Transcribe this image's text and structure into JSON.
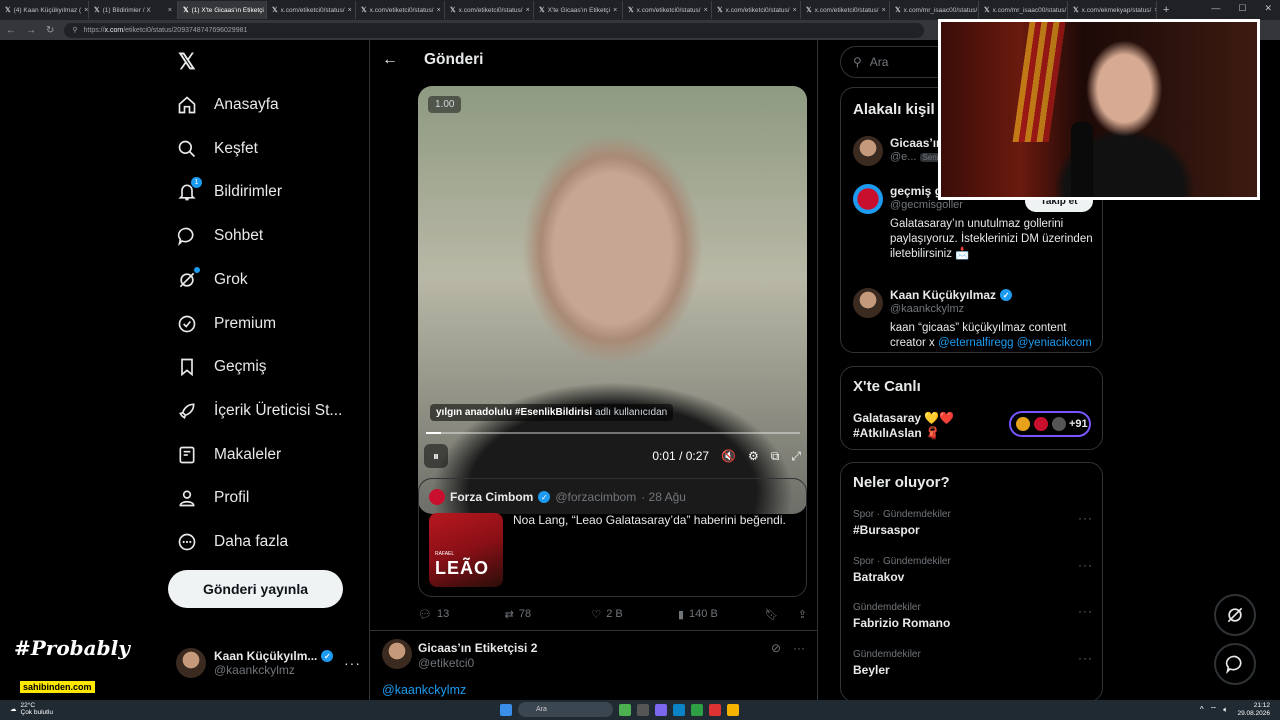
{
  "browser": {
    "tabs": [
      {
        "label": "(4) Kaan Küçükyılmaz ("
      },
      {
        "label": "(1) Bildirimler / X"
      },
      {
        "label": "(1) X'te Gicaas'ın Etiketçi"
      },
      {
        "label": "x.com/etiketci0/status/"
      },
      {
        "label": "x.com/etiketci0/status/"
      },
      {
        "label": "x.com/etiketci0/status/"
      },
      {
        "label": "X'te Gicaas'ın Etiketçi"
      },
      {
        "label": "x.com/etiketci0/status/"
      },
      {
        "label": "x.com/etiketci0/status/"
      },
      {
        "label": "x.com/etiketci0/status/"
      },
      {
        "label": "x.com/mr_isaac00/status/"
      },
      {
        "label": "x.com/mr_isaac00/status/"
      },
      {
        "label": "x.com/ekmekyap/status/"
      }
    ],
    "url_prefix": "https://",
    "url_host": "x.com",
    "url_path": "/etiketci0/status/2093748747696029981",
    "new_tab": "+"
  },
  "nav": {
    "items": [
      {
        "label": "Anasayfa",
        "icon": "home-icon"
      },
      {
        "label": "Keşfet",
        "icon": "search-icon"
      },
      {
        "label": "Bildirimler",
        "icon": "bell-icon",
        "badge": "1"
      },
      {
        "label": "Sohbet",
        "icon": "chat-icon"
      },
      {
        "label": "Grok",
        "icon": "grok-icon"
      },
      {
        "label": "Premium",
        "icon": "premium-icon"
      },
      {
        "label": "Geçmiş",
        "icon": "bookmark-icon"
      },
      {
        "label": "İçerik Üreticisi St...",
        "icon": "rocket-icon"
      },
      {
        "label": "Makaleler",
        "icon": "articles-icon"
      },
      {
        "label": "Profil",
        "icon": "profile-icon"
      },
      {
        "label": "Daha fazla",
        "icon": "more-circle-icon"
      }
    ],
    "post_button": "Gönderi yayınla",
    "account": {
      "name": "Kaan Küçükyılm...",
      "handle": "@kaankckylmz",
      "more": "···"
    }
  },
  "main": {
    "title": "Gönderi",
    "video": {
      "speed": "1.00",
      "caption_user": "yılgın anadolulu #EsenlikBildirisi",
      "caption_suffix": "adlı kullanıcıdan",
      "time": "0:01 / 0:27",
      "progress": 0.04
    },
    "quote": {
      "name": "Forza Cimbom",
      "handle": "@forzacimbom",
      "date": "· 28 Ağu",
      "text": "Noa Lang, “Leao Galatasaray’da” haberini beğendi.",
      "image_text": "LEÃO",
      "image_subtext": "RAFAEL"
    },
    "actions": {
      "replies": "13",
      "reposts": "78",
      "likes": "2 B",
      "views": "140 B"
    },
    "reply": {
      "name": "Gicaas’ın Etiketçisi 2",
      "handle": "@etiketci0",
      "mention": "@kaankckylmz",
      "more": "···"
    }
  },
  "right": {
    "search_placeholder": "Ara",
    "related_title": "Alakalı kişil",
    "people": [
      {
        "name": "Gicaas’ın",
        "handle": "@e...",
        "tag": "Seni"
      },
      {
        "name": "geçmiş g",
        "handle": "@gecmisgoller",
        "bio": "Galatasaray’ın unutulmaz gollerini paylaşıyoruz. İsteklerinizi DM üzerinden iletebilirsiniz 📩"
      },
      {
        "name": "Kaan Küçükyılmaz",
        "handle": "@kaankckylmz",
        "bio_pre": "kaan “gicaas” küçükyılmaz content creator x ",
        "mention1": "@eternalfiregg",
        "mention2": "@yeniacikcom"
      }
    ],
    "follow_label": "Takip et",
    "live": {
      "title": "X'te Canlı",
      "line1": "Galatasaray 💛❤️",
      "line2": "#AtkılıAslan 🧣",
      "count": "+91"
    },
    "trends_title": "Neler oluyor?",
    "trends": [
      {
        "category": "Spor · Gündemdekiler",
        "name": "#Bursaspor"
      },
      {
        "category": "Spor · Gündemdekiler",
        "name": "Batrakov"
      },
      {
        "category": "Gündemdekiler",
        "name": "Fabrizio Romano"
      },
      {
        "category": "Gündemdekiler",
        "name": "Beyler"
      }
    ],
    "trend_more": "···"
  },
  "overlay": {
    "probably": "#Probably",
    "sponsor": "sahibinden.com"
  },
  "taskbar": {
    "temp": "22°C",
    "weather": "Çok bulutlu",
    "search": "Ara",
    "time": "21:12",
    "date": "29.08.2026"
  },
  "colors": {
    "accent": "#1d9bf0",
    "background": "#000000",
    "border": "#2f3336",
    "live_ring": "#7856ff"
  }
}
